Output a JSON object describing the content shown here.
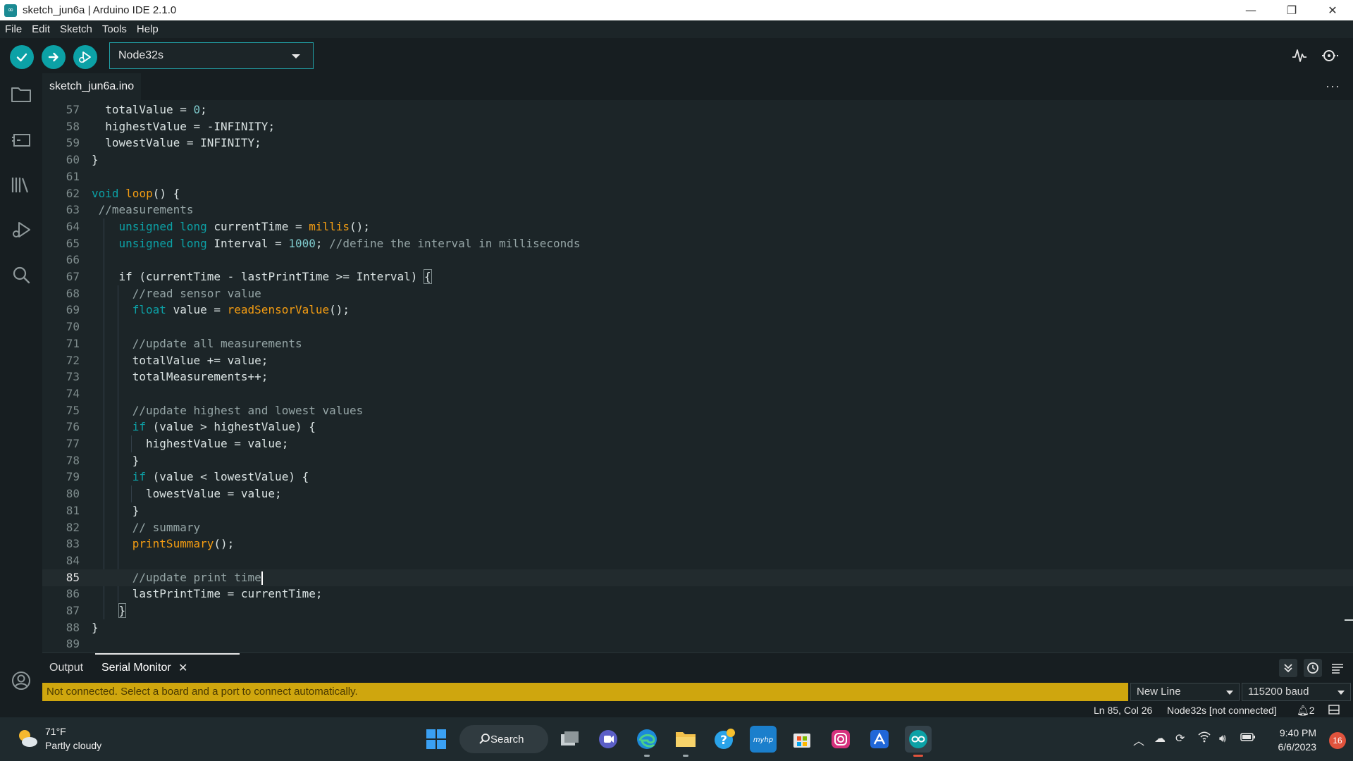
{
  "window": {
    "title": "sketch_jun6a | Arduino IDE 2.1.0",
    "app_icon_glyph": "∞",
    "controls": {
      "minimize": "—",
      "maximize": "❐",
      "close": "✕"
    }
  },
  "menu": [
    "File",
    "Edit",
    "Sketch",
    "Tools",
    "Help"
  ],
  "toolbar": {
    "board": "Node32s",
    "buttons": [
      "verify-icon",
      "upload-icon",
      "debug-icon"
    ],
    "right_icons": [
      "serial-plotter-icon",
      "serial-monitor-icon"
    ]
  },
  "activity_icons": [
    "folder-icon",
    "board-manager-icon",
    "library-icon",
    "debug-icon",
    "search-icon",
    "account-icon"
  ],
  "editor": {
    "tab": "sketch_jun6a.ino",
    "more": "···",
    "current_line": 85,
    "lines": [
      {
        "n": "57",
        "indent": 1,
        "tokens": [
          [
            "",
            "totalValue = "
          ],
          [
            "num",
            "0"
          ],
          [
            "",
            ";"
          ]
        ]
      },
      {
        "n": "58",
        "indent": 1,
        "tokens": [
          [
            "",
            "highestValue = -INFINITY;"
          ]
        ]
      },
      {
        "n": "59",
        "indent": 1,
        "tokens": [
          [
            "",
            "lowestValue = INFINITY;"
          ]
        ]
      },
      {
        "n": "60",
        "indent": 0,
        "tokens": [
          [
            "",
            "}"
          ]
        ]
      },
      {
        "n": "61",
        "indent": 0,
        "tokens": []
      },
      {
        "n": "62",
        "indent": 0,
        "tokens": [
          [
            "kw",
            "void"
          ],
          [
            "",
            " "
          ],
          [
            "fn",
            "loop"
          ],
          [
            "",
            "() {"
          ]
        ]
      },
      {
        "n": "63",
        "indent": 0,
        "tokens": [
          [
            "cm",
            " //measurements"
          ]
        ]
      },
      {
        "n": "64",
        "indent": 2,
        "tokens": [
          [
            "kw",
            "unsigned"
          ],
          [
            "",
            " "
          ],
          [
            "kw",
            "long"
          ],
          [
            "",
            " currentTime = "
          ],
          [
            "fn",
            "millis"
          ],
          [
            "",
            "();"
          ]
        ]
      },
      {
        "n": "65",
        "indent": 2,
        "tokens": [
          [
            "kw",
            "unsigned"
          ],
          [
            "",
            " "
          ],
          [
            "kw",
            "long"
          ],
          [
            "",
            " Interval = "
          ],
          [
            "num",
            "1000"
          ],
          [
            "",
            "; "
          ],
          [
            "cm",
            "//define the interval in milliseconds"
          ]
        ]
      },
      {
        "n": "66",
        "indent": 0,
        "tokens": []
      },
      {
        "n": "67",
        "indent": 2,
        "tokens": [
          [
            "",
            "if (currentTime - lastPrintTime >= Interval) "
          ],
          [
            "br",
            "{"
          ]
        ]
      },
      {
        "n": "68",
        "indent": 3,
        "tokens": [
          [
            "cm",
            "//read sensor value"
          ]
        ]
      },
      {
        "n": "69",
        "indent": 3,
        "tokens": [
          [
            "kw",
            "float"
          ],
          [
            "",
            " value = "
          ],
          [
            "fn",
            "readSensorValue"
          ],
          [
            "",
            "();"
          ]
        ]
      },
      {
        "n": "70",
        "indent": 0,
        "tokens": []
      },
      {
        "n": "71",
        "indent": 3,
        "tokens": [
          [
            "cm",
            "//update all measurements"
          ]
        ]
      },
      {
        "n": "72",
        "indent": 3,
        "tokens": [
          [
            "",
            "totalValue += value;"
          ]
        ]
      },
      {
        "n": "73",
        "indent": 3,
        "tokens": [
          [
            "",
            "totalMeasurements++;"
          ]
        ]
      },
      {
        "n": "74",
        "indent": 0,
        "tokens": []
      },
      {
        "n": "75",
        "indent": 3,
        "tokens": [
          [
            "cm",
            "//update highest and lowest values"
          ]
        ]
      },
      {
        "n": "76",
        "indent": 3,
        "tokens": [
          [
            "kw",
            "if"
          ],
          [
            "",
            " (value > highestValue) {"
          ]
        ]
      },
      {
        "n": "77",
        "indent": 4,
        "tokens": [
          [
            "",
            "highestValue = value;"
          ]
        ]
      },
      {
        "n": "78",
        "indent": 3,
        "tokens": [
          [
            "",
            "}"
          ]
        ]
      },
      {
        "n": "79",
        "indent": 3,
        "tokens": [
          [
            "kw",
            "if"
          ],
          [
            "",
            " (value < lowestValue) {"
          ]
        ]
      },
      {
        "n": "80",
        "indent": 4,
        "tokens": [
          [
            "",
            "lowestValue = value;"
          ]
        ]
      },
      {
        "n": "81",
        "indent": 3,
        "tokens": [
          [
            "",
            "}"
          ]
        ]
      },
      {
        "n": "82",
        "indent": 3,
        "tokens": [
          [
            "cm",
            "// summary"
          ]
        ]
      },
      {
        "n": "83",
        "indent": 3,
        "tokens": [
          [
            "fn",
            "printSummary"
          ],
          [
            "",
            "();"
          ]
        ]
      },
      {
        "n": "84",
        "indent": 0,
        "tokens": []
      },
      {
        "n": "85",
        "indent": 3,
        "tokens": [
          [
            "cm",
            "//update print time"
          ],
          [
            "cursor",
            ""
          ]
        ]
      },
      {
        "n": "86",
        "indent": 3,
        "tokens": [
          [
            "",
            "lastPrintTime = currentTime;"
          ]
        ]
      },
      {
        "n": "87",
        "indent": 2,
        "tokens": [
          [
            "br",
            "}"
          ]
        ]
      },
      {
        "n": "88",
        "indent": 0,
        "tokens": [
          [
            "",
            "}"
          ]
        ]
      },
      {
        "n": "89",
        "indent": 0,
        "tokens": []
      }
    ]
  },
  "panel": {
    "tabs": [
      "Output",
      "Serial Monitor"
    ],
    "close": "✕",
    "warning": "Not connected. Select a board and a port to connect automatically.",
    "line_ending": "New Line",
    "baud": "115200 baud",
    "icons": [
      "collapse-icon",
      "timestamp-icon",
      "clear-output-icon"
    ]
  },
  "status": {
    "position": "Ln 85, Col 26",
    "board": "Node32s [not connected]",
    "notifications": "2"
  },
  "taskbar": {
    "temperature": "71°F",
    "weather": "Partly cloudy",
    "search": "Search",
    "time": "9:40 PM",
    "date": "6/6/2023",
    "badge": "16",
    "apps": [
      "start-icon",
      "task-view-icon",
      "teams-chat-icon",
      "edge-icon",
      "file-explorer-icon",
      "help-icon",
      "myhp-icon",
      "store-icon",
      "instagram-icon",
      "remote-app-icon",
      "arduino-icon"
    ]
  },
  "colors": {
    "accent": "#0ca1a6",
    "editor_bg": "#1c2528",
    "warning_bg": "#cfa60e",
    "keyword": "#0ca1a6",
    "function": "#f39c12",
    "comment": "#95a5a6"
  }
}
